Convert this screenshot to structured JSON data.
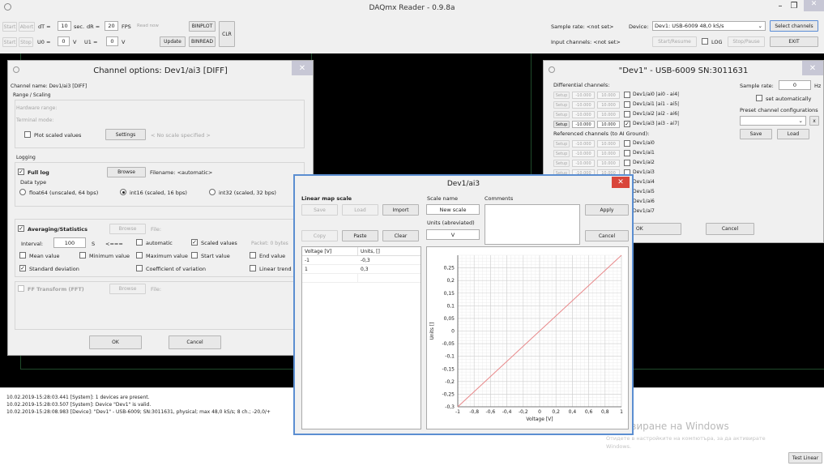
{
  "app": {
    "title": "DAQmx Reader - 0.9.8a"
  },
  "toolbar": {
    "start": "Start",
    "abort": "Abort",
    "dt_label": "dT =",
    "dt_value": "10",
    "sec": "sec.",
    "dr_label": "dR =",
    "dr_value": "20",
    "fps": "FPS",
    "read_now": "Read now",
    "binplot": "BINPLOT",
    "start2": "Start",
    "stop": "Stop",
    "u0_label": "U0 =",
    "u0_value": "0",
    "v1": "V",
    "u1_label": "U1 =",
    "u1_value": "0",
    "v2": "V",
    "update": "Update",
    "binread": "BINREAD",
    "clr": "CLR",
    "sample_rate": "Sample rate: <not set>",
    "input_channels": "Input channels: <not set>",
    "device_label": "Device:",
    "device_value": "Dev1: USB-6009 48,0 kS/s",
    "select_channels": "Select channels",
    "start_resume": "Start/Resume",
    "log": "LOG",
    "stop_pause": "Stop/Pause",
    "exit": "EXIT"
  },
  "channel_options": {
    "title": "Channel options: Dev1/ai3 [DIFF]",
    "channel_name": "Channel name: Dev1/ai3 [DIFF]",
    "range_scaling": "Range / Scaling",
    "hardware_range": "Hardware range:",
    "terminal_mode": "Terminal mode:",
    "plot_scaled": "Plot scaled values",
    "settings": "Settings",
    "no_scale": "< No scale specified >",
    "logging": "Logging",
    "full_log": "Full log",
    "browse": "Browse",
    "filename": "Filename: <automatic>",
    "data_type": "Data type",
    "float64": "float64 (unscaled, 64 bps)",
    "int16": "int16 (scaled, 16 bps)",
    "int32": "int32 (scaled, 32 bps)",
    "avg_stats": "Averaging/Statistics",
    "browse2": "Browse",
    "file": "File:",
    "interval_label": "Interval:",
    "interval_value": "100",
    "s": "S",
    "arrow": "<===",
    "automatic": "automatic",
    "scaled_values": "Scaled values",
    "packet": "Packet: 0 bytes",
    "mean": "Mean value",
    "min": "Minimum value",
    "max": "Maximum value",
    "start_value": "Start value",
    "end_value": "End value",
    "std": "Standard deviation",
    "coef": "Coefficient of variation",
    "linear_trend": "Linear trend",
    "fft": "FF Transform (FFT)",
    "browse3": "Browse",
    "file2": "File:",
    "ok": "OK",
    "cancel": "Cancel"
  },
  "device_window": {
    "title": "\"Dev1\" - USB-6009 SN:3011631",
    "diff_header": "Differential channels:",
    "ref_header": "Referenced channels (to AI Ground):",
    "setup": "Setup",
    "min": "-10.000",
    "max": "10.000",
    "diff_channels": [
      "Dev1/ai0 |ai0 - ai4|",
      "Dev1/ai1 |ai1 - ai5|",
      "Dev1/ai2 |ai2 - ai6|",
      "Dev1/ai3 |ai3 - ai7|"
    ],
    "ref_channels": [
      "Dev1/ai0",
      "Dev1/ai1",
      "Dev1/ai2",
      "Dev1/ai3",
      "Dev1/ai4",
      "Dev1/ai5",
      "Dev1/ai6",
      "Dev1/ai7"
    ],
    "sample_rate_label": "Sample rate:",
    "sample_rate_value": "0",
    "hz": "Hz",
    "set_auto": "set automatically",
    "preset": "Preset channel configurations",
    "x": "x",
    "save": "Save",
    "load": "Load",
    "ok": "OK",
    "cancel": "Cancel"
  },
  "scale_dialog": {
    "title": "Dev1/ai3",
    "linear_map_scale": "Linear map scale",
    "save": "Save",
    "load": "Load",
    "import": "Import",
    "scale_name_label": "Scale name",
    "scale_name_value": "New scale",
    "comments": "Comments",
    "apply": "Apply",
    "units_label": "Units (abreviated)",
    "units_value": "V",
    "copy": "Copy",
    "paste": "Paste",
    "clear": "Clear",
    "cancel": "Cancel",
    "table_headers": [
      "Voltage [V]",
      "Units, []"
    ],
    "table_rows": [
      [
        "-1",
        "-0,3"
      ],
      [
        "1",
        "0,3"
      ]
    ]
  },
  "log": {
    "lines": [
      "10.02.2019-15:28:03.441 [System]: 1 devices are present.",
      "10.02.2019-15:28:03.507 [System]: Device \"Dev1\" is valid.",
      "10.02.2019-15:28:08.983 [Device]: \"Dev1\" - USB-6009; SN:3011631, physical; max 48,0 kS/s; 8 ch.; -20,0/+"
    ]
  },
  "watermark": {
    "line1": "Активиране на Windows",
    "line2": "Отидете в настройките на компютъра, за да активирате",
    "line3": "Windows."
  },
  "footer": {
    "test_linear": "Test Linear"
  },
  "chart_data": {
    "type": "line",
    "x": [
      -1,
      1
    ],
    "series": [
      {
        "values": [
          -0.3,
          0.3
        ],
        "color": "#e8888a"
      }
    ],
    "xlabel": "Voltage [V]",
    "ylabel": "Units []",
    "xlim": [
      -1,
      1
    ],
    "ylim": [
      -0.3,
      0.3
    ],
    "xticks": [
      "-1",
      "-0,8",
      "-0,6",
      "-0,4",
      "-0,2",
      "0",
      "0,2",
      "0,4",
      "0,6",
      "0,8",
      "1"
    ],
    "yticks": [
      "-0,3",
      "-0,25",
      "-0,2",
      "-0,15",
      "-0,1",
      "-0,05",
      "0",
      "0,05",
      "0,1",
      "0,15",
      "0,2",
      "0,25"
    ],
    "grid": true
  }
}
